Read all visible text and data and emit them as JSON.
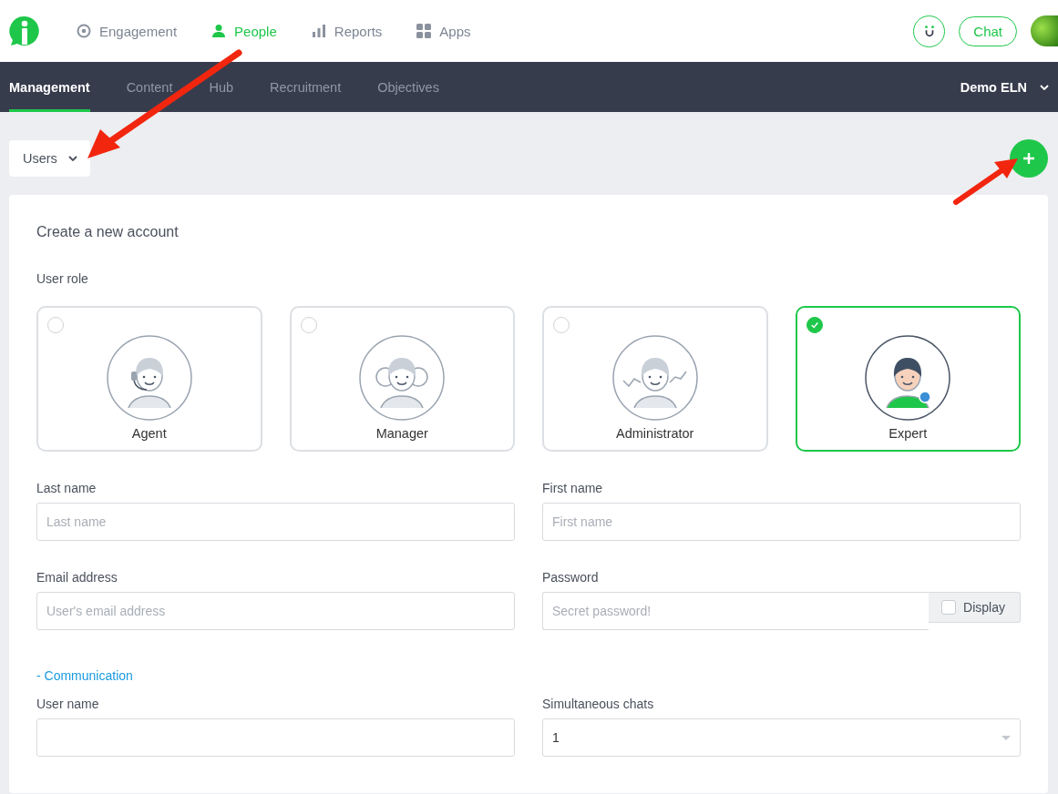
{
  "top_nav": [
    {
      "label": "Engagement",
      "kind": "target",
      "selected": false
    },
    {
      "label": "People",
      "kind": "person",
      "selected": true
    },
    {
      "label": "Reports",
      "kind": "bars",
      "selected": false
    },
    {
      "label": "Apps",
      "kind": "grid",
      "selected": false
    }
  ],
  "chat_button": "Chat",
  "sub_nav": {
    "tabs": [
      {
        "label": "Management",
        "selected": true
      },
      {
        "label": "Content",
        "selected": false
      },
      {
        "label": "Hub",
        "selected": false
      },
      {
        "label": "Recruitment",
        "selected": false
      },
      {
        "label": "Objectives",
        "selected": false
      }
    ],
    "account": "Demo ELN"
  },
  "section_dropdown": "Users",
  "form": {
    "title": "Create a new account",
    "role_label": "User role",
    "roles": [
      {
        "name": "Agent",
        "kind": "headset",
        "selected": false
      },
      {
        "name": "Manager",
        "kind": "group",
        "selected": false
      },
      {
        "name": "Administrator",
        "kind": "chart",
        "selected": false
      },
      {
        "name": "Expert",
        "kind": "award",
        "selected": true
      }
    ],
    "fields": [
      {
        "label": "Last name",
        "placeholder": "Last name",
        "kind": "text"
      },
      {
        "label": "First name",
        "placeholder": "First name",
        "kind": "text"
      },
      {
        "label": "Email address",
        "placeholder": "User's email address",
        "kind": "text"
      },
      {
        "label": "Password",
        "placeholder": "Secret password!",
        "kind": "password",
        "toggle": {
          "label": "Display",
          "checked": false
        }
      }
    ],
    "section_link": "- Communication",
    "fields_2": [
      {
        "label": "User name",
        "kind": "text"
      },
      {
        "label": "Simultaneous chats",
        "kind": "select",
        "value": "1"
      }
    ]
  }
}
